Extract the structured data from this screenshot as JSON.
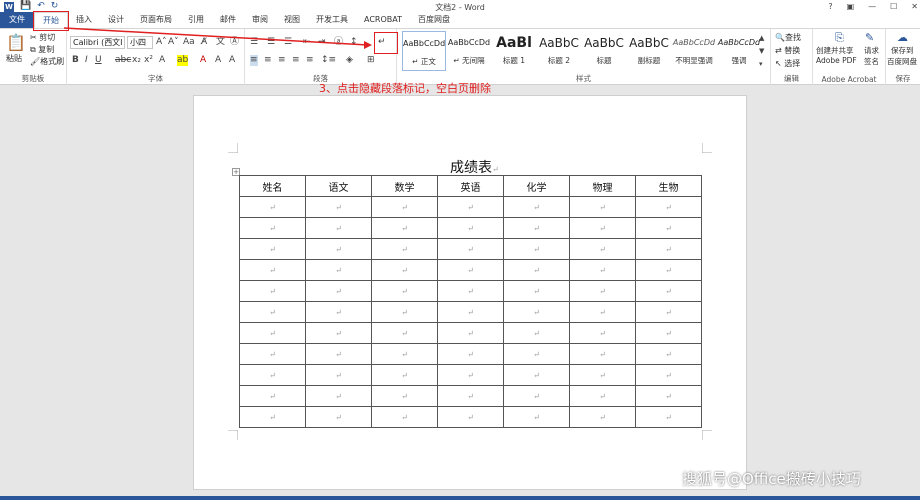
{
  "window": {
    "title": "文档2 - Word",
    "controls": [
      "?",
      "▣",
      "—",
      "☐",
      "✕"
    ]
  },
  "qat": {
    "save": "💾",
    "undo": "↶",
    "redo": "↻"
  },
  "tabs": [
    "文件",
    "开始",
    "插入",
    "设计",
    "页面布局",
    "引用",
    "邮件",
    "审阅",
    "视图",
    "开发工具",
    "ACROBAT",
    "百度网盘"
  ],
  "clipboard": {
    "paste": "粘贴",
    "cut": "剪切",
    "copy": "复制",
    "format_painter": "格式刷",
    "label": "剪贴板"
  },
  "font": {
    "name": "Calibri (西文I",
    "size": "小四",
    "label": "字体"
  },
  "paragraph": {
    "label": "段落"
  },
  "styles": {
    "label": "样式",
    "items": [
      {
        "preview": "AaBbCcDd",
        "label": "↵ 正文"
      },
      {
        "preview": "AaBbCcDd",
        "label": "↵ 无间隔"
      },
      {
        "preview": "AaBl",
        "label": "标题 1"
      },
      {
        "preview": "AaBbC",
        "label": "标题 2"
      },
      {
        "preview": "AaBbC",
        "label": "标题"
      },
      {
        "preview": "AaBbC",
        "label": "副标题"
      },
      {
        "preview": "AaBbCcDd",
        "label": "不明显强调"
      },
      {
        "preview": "AaBbCcDd",
        "label": "强调"
      }
    ]
  },
  "editing": {
    "find": "查找",
    "replace": "替换",
    "select": "选择",
    "label": "编辑"
  },
  "acrobat": {
    "create": "创建并共享",
    "create2": "Adobe PDF",
    "sign": "请求",
    "sign2": "签名",
    "label": "Adobe Acrobat"
  },
  "save_group": {
    "save": "保存到",
    "save2": "百度网盘",
    "label": "保存"
  },
  "annotation": "3、点击隐藏段落标记，空白页删除",
  "document": {
    "title": "成绩表",
    "headers": [
      "姓名",
      "语文",
      "数学",
      "英语",
      "化学",
      "物理",
      "生物"
    ],
    "row_count": 11,
    "cell_mark": "↵"
  },
  "watermark": "搜狐号@Office搬砖小技巧",
  "colors": {
    "accent": "#2b579a",
    "annotation": "#e02020"
  }
}
